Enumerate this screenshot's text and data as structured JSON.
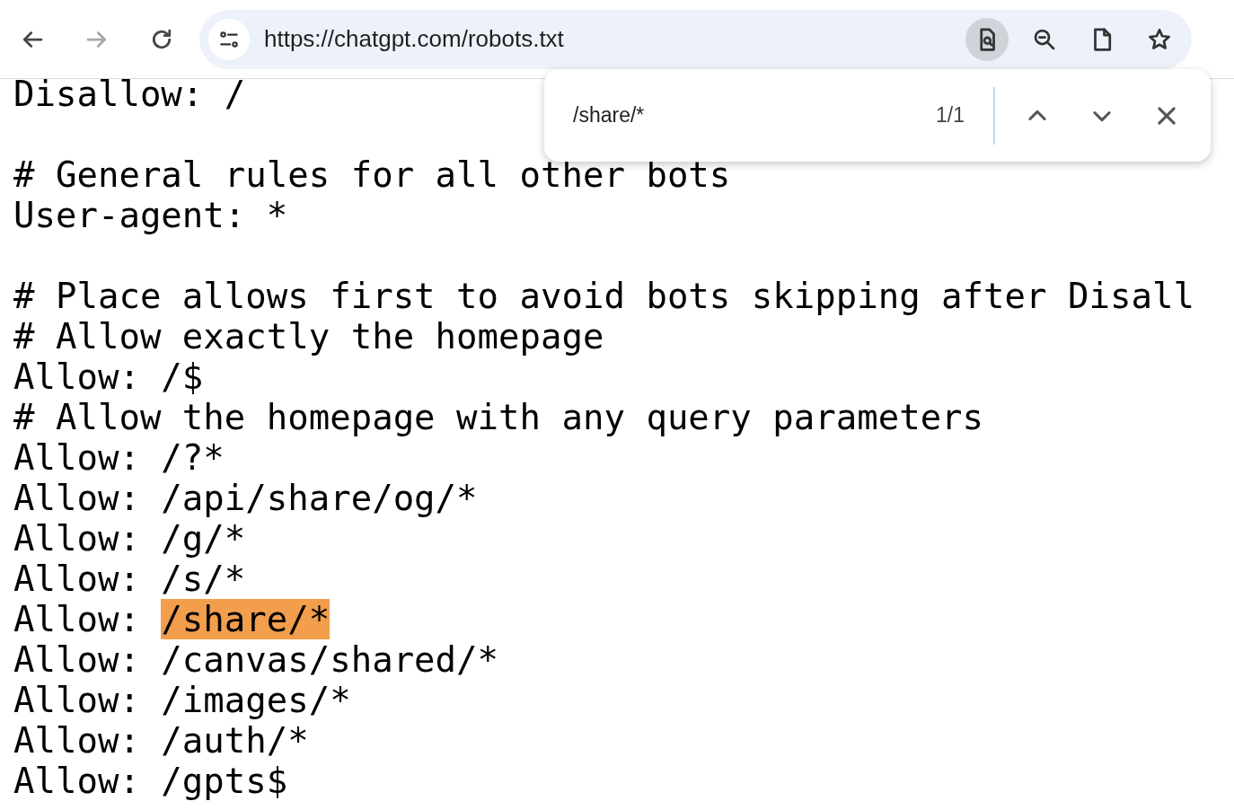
{
  "toolbar": {
    "nav_buttons": [
      {
        "kind": "back",
        "disabled": false
      },
      {
        "kind": "forward",
        "disabled": true
      },
      {
        "kind": "reload",
        "disabled": false
      }
    ],
    "address_bar": {
      "url": "https://chatgpt.com/robots.txt"
    },
    "icons": [
      {
        "kind": "find",
        "selected": true
      },
      {
        "kind": "zoom",
        "selected": false
      },
      {
        "kind": "document",
        "selected": false
      },
      {
        "kind": "bookmark",
        "selected": false
      }
    ]
  },
  "find_bar": {
    "query": "/share/*",
    "count": "1/1"
  },
  "document": {
    "lines": [
      {
        "kind": "text",
        "segments": [
          {
            "text": "Disallow: /",
            "highlighted": false
          }
        ]
      },
      {
        "kind": "blank"
      },
      {
        "kind": "text",
        "segments": [
          {
            "text": "# General rules for all other bots",
            "highlighted": false
          }
        ]
      },
      {
        "kind": "text",
        "segments": [
          {
            "text": "User-agent: *",
            "highlighted": false
          }
        ]
      },
      {
        "kind": "blank"
      },
      {
        "kind": "text",
        "segments": [
          {
            "text": "# Place allows first to avoid bots skipping after Disall",
            "highlighted": false
          }
        ]
      },
      {
        "kind": "text",
        "segments": [
          {
            "text": "# Allow exactly the homepage",
            "highlighted": false
          }
        ]
      },
      {
        "kind": "text",
        "segments": [
          {
            "text": "Allow: /$",
            "highlighted": false
          }
        ]
      },
      {
        "kind": "text",
        "segments": [
          {
            "text": "# Allow the homepage with any query parameters",
            "highlighted": false
          }
        ]
      },
      {
        "kind": "text",
        "segments": [
          {
            "text": "Allow: /?*",
            "highlighted": false
          }
        ]
      },
      {
        "kind": "text",
        "segments": [
          {
            "text": "Allow: /api/share/og/*",
            "highlighted": false
          }
        ]
      },
      {
        "kind": "text",
        "segments": [
          {
            "text": "Allow: /g/*",
            "highlighted": false
          }
        ]
      },
      {
        "kind": "text",
        "segments": [
          {
            "text": "Allow: /s/*",
            "highlighted": false
          }
        ]
      },
      {
        "kind": "text",
        "segments": [
          {
            "text": "Allow: ",
            "highlighted": false
          },
          {
            "text": "/share/*",
            "highlighted": true
          }
        ]
      },
      {
        "kind": "text",
        "segments": [
          {
            "text": "Allow: /canvas/shared/*",
            "highlighted": false
          }
        ]
      },
      {
        "kind": "text",
        "segments": [
          {
            "text": "Allow: /images/*",
            "highlighted": false
          }
        ]
      },
      {
        "kind": "text",
        "segments": [
          {
            "text": "Allow: /auth/*",
            "highlighted": false
          }
        ]
      },
      {
        "kind": "text",
        "segments": [
          {
            "text": "Allow: /gpts$",
            "highlighted": false
          }
        ]
      }
    ]
  }
}
